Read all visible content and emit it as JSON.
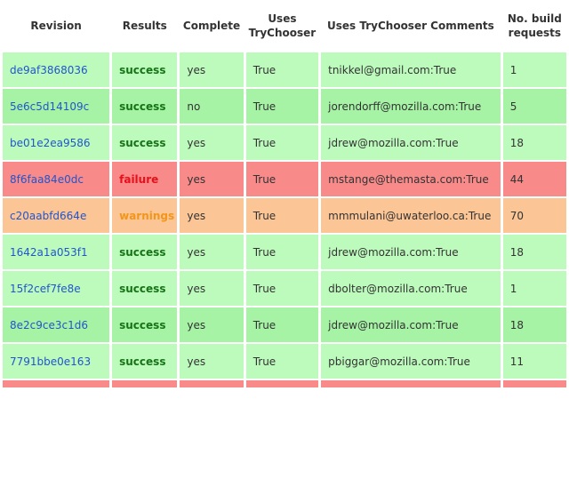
{
  "table": {
    "headers": {
      "revision": "Revision",
      "results": "Results",
      "complete": "Complete",
      "uses_trychooser": "Uses TryChooser",
      "comments": "Uses TryChooser Comments",
      "build_requests": "No. build requests"
    },
    "rows": [
      {
        "revision": "de9af3868036",
        "result": "success",
        "complete": "yes",
        "uses_trychooser": "True",
        "comments": "tnikkel@gmail.com:True",
        "build_requests": "1"
      },
      {
        "revision": "5e6c5d14109c",
        "result": "success",
        "complete": "no",
        "uses_trychooser": "True",
        "comments": "jorendorff@mozilla.com:True",
        "build_requests": "5"
      },
      {
        "revision": "be01e2ea9586",
        "result": "success",
        "complete": "yes",
        "uses_trychooser": "True",
        "comments": "jdrew@mozilla.com:True",
        "build_requests": "18"
      },
      {
        "revision": "8f6faa84e0dc",
        "result": "failure",
        "complete": "yes",
        "uses_trychooser": "True",
        "comments": "mstange@themasta.com:True",
        "build_requests": "44"
      },
      {
        "revision": "c20aabfd664e",
        "result": "warnings",
        "complete": "yes",
        "uses_trychooser": "True",
        "comments": "mmmulani@uwaterloo.ca:True",
        "build_requests": "70"
      },
      {
        "revision": "1642a1a053f1",
        "result": "success",
        "complete": "yes",
        "uses_trychooser": "True",
        "comments": "jdrew@mozilla.com:True",
        "build_requests": "18"
      },
      {
        "revision": "15f2cef7fe8e",
        "result": "success",
        "complete": "yes",
        "uses_trychooser": "True",
        "comments": "dbolter@mozilla.com:True",
        "build_requests": "1"
      },
      {
        "revision": "8e2c9ce3c1d6",
        "result": "success",
        "complete": "yes",
        "uses_trychooser": "True",
        "comments": "jdrew@mozilla.com:True",
        "build_requests": "18"
      },
      {
        "revision": "7791bbe0e163",
        "result": "success",
        "complete": "yes",
        "uses_trychooser": "True",
        "comments": "pbiggar@mozilla.com:True",
        "build_requests": "11"
      }
    ]
  },
  "colors": {
    "success_row": "#bdfbbd",
    "success_row_alt": "#a6f3a6",
    "failure_row": "#f88a8a",
    "warnings_row": "#fbc596",
    "success_text": "#167416",
    "failure_text": "#e8101a",
    "warnings_text": "#f2961a",
    "link": "#2255cc"
  }
}
